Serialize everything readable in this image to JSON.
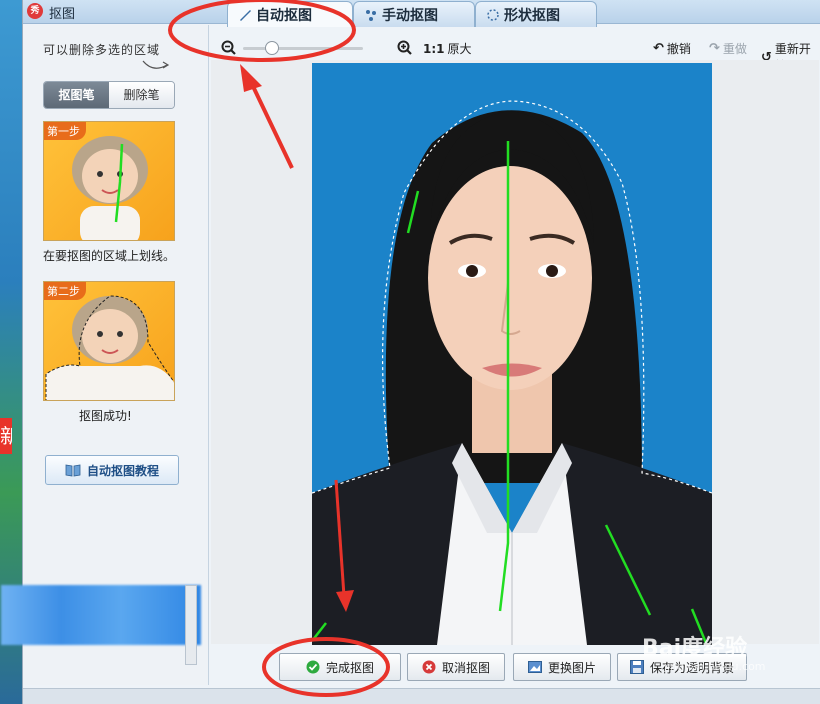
{
  "window": {
    "title": "抠图"
  },
  "tabs": [
    {
      "label": "自动抠图",
      "active": true
    },
    {
      "label": "手动抠图",
      "active": false
    },
    {
      "label": "形状抠图",
      "active": false
    }
  ],
  "left_panel": {
    "hint": "可以删除多选的区域",
    "mode_buttons": [
      "抠图笔",
      "删除笔"
    ],
    "active_mode": "抠图笔",
    "step1": {
      "badge": "第一步",
      "caption": "在要抠图的区域上划线。"
    },
    "step2": {
      "badge": "第二步",
      "caption": "抠图成功!"
    },
    "tutorial_button": "自动抠图教程"
  },
  "toolbar": {
    "zoom_level": 0.18,
    "original_size_prefix": "1:1",
    "original_size_label": "原大",
    "undo": "撤销",
    "redo": "重做",
    "restart": "重新开始"
  },
  "actions": {
    "finish": "完成抠图",
    "cancel": "取消抠图",
    "replace": "更换图片",
    "save_transparent": "保存为透明背景"
  },
  "watermark": {
    "brand": "Bai度经验",
    "url": "jingyan.baidu.com"
  },
  "colors": {
    "photo_bg": "#1b83c9",
    "stroke_green": "#22dd22",
    "annotation_red": "#e8332a"
  }
}
